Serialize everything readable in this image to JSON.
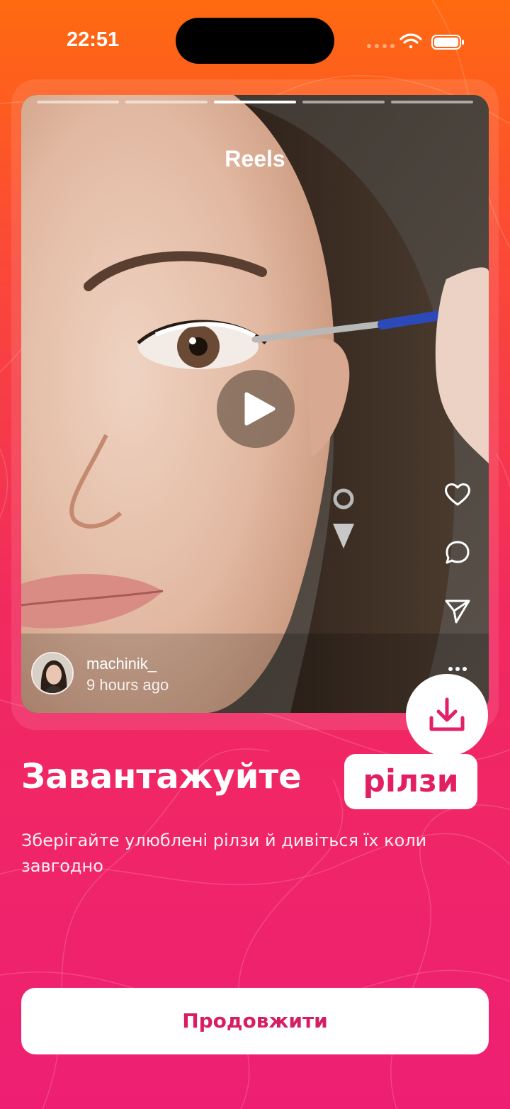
{
  "status_bar": {
    "time": "22:51",
    "icons": [
      "signal-icon",
      "wifi-icon",
      "battery-icon"
    ]
  },
  "reel": {
    "title": "Reels",
    "progress_segments": 5,
    "active_segment": 3,
    "author": {
      "username": "machinik_",
      "posted": "9 hours ago"
    },
    "side_actions": [
      "heart-icon",
      "comment-icon",
      "send-icon",
      "more-icon"
    ],
    "center_action": "play-icon"
  },
  "download_icon": "download-icon",
  "headline": {
    "text": "Завантажуйте",
    "highlight": "рілзи"
  },
  "subtitle": "Зберігайте улюблені рілзи й дивіться їх коли завгодно",
  "continue_button": "Продовжити",
  "colors": {
    "gradient_top": "#ff6a10",
    "gradient_bottom": "#ee1f73",
    "accent_text": "#e31f63",
    "button_text": "#d61e64"
  }
}
